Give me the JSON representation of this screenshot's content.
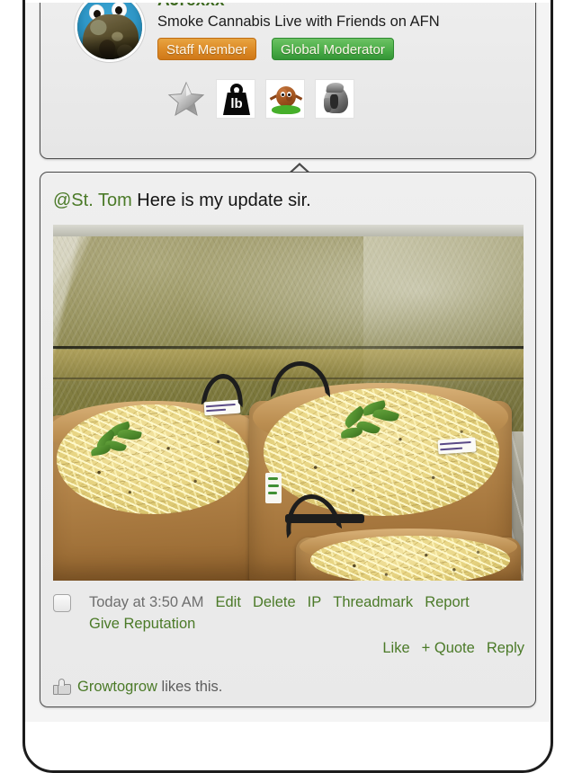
{
  "user": {
    "name": "AJrexxx",
    "tagline": "Smoke Cannabis Live with Friends on AFN",
    "avatar_icon": "avatar-cookie-monster-nug",
    "badges": [
      {
        "label": "Staff Member",
        "color": "#dd8c28"
      },
      {
        "label": "Global Moderator",
        "color": "#4cae49"
      }
    ],
    "trophies": [
      {
        "name": "silver-star-icon",
        "title": "Star"
      },
      {
        "name": "pound-weight-icon",
        "title": "lb"
      },
      {
        "name": "nug-character-icon",
        "title": "Nug"
      },
      {
        "name": "gladiator-helmet-icon",
        "title": "Helmet"
      }
    ]
  },
  "post": {
    "mention": "@St. Tom",
    "text": " Here is my update sir.",
    "photo": {
      "name": "grow-tent-photo",
      "alt": "Three tan fabric pots with straw mulch and cannabis seedlings inside a reflective grow tent"
    },
    "date": "Today at 3:50 AM",
    "meta_links": [
      "Edit",
      "Delete",
      "IP",
      "Threadmark",
      "Report"
    ],
    "give_reputation": "Give Reputation",
    "actions": [
      "Like",
      "+ Quote",
      "Reply"
    ],
    "likes": {
      "icon": "thumbs-up-icon",
      "liker": "Growtogrow",
      "suffix": " likes this."
    }
  },
  "theme": {
    "link_green": "#4b7a28",
    "username_green": "#3f6b22",
    "muted_gray": "#6e6e6e",
    "card_bg": "#ececec"
  }
}
